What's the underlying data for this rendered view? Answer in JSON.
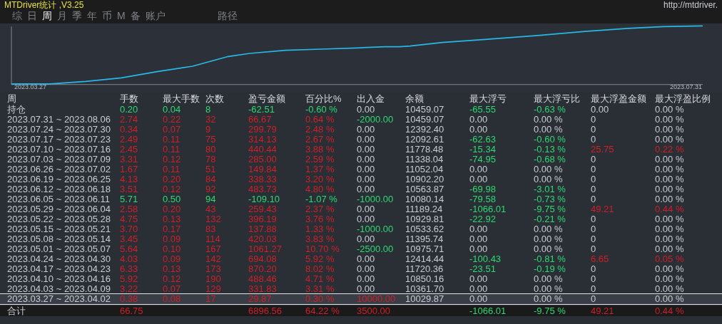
{
  "window": {
    "title": "MTDriver统计 ,V3.25",
    "url": "http://mtdriver."
  },
  "tabs": [
    {
      "label": "综",
      "selected": false
    },
    {
      "label": "日",
      "selected": false
    },
    {
      "label": "周",
      "selected": true
    },
    {
      "label": "月",
      "selected": false
    },
    {
      "label": "季",
      "selected": false
    },
    {
      "label": "年",
      "selected": false
    },
    {
      "label": "币",
      "selected": false
    },
    {
      "label": "M",
      "selected": false
    },
    {
      "label": "备",
      "selected": false
    },
    {
      "label": "账户",
      "selected": false
    },
    {
      "label": "路径",
      "selected": false
    }
  ],
  "chart": {
    "start_label": "2023.03.27",
    "end_label": "2023.07.31"
  },
  "table": {
    "columns": [
      "周",
      "手数",
      "最大手数",
      "次数",
      "盈亏金额",
      "百分比%",
      "出入金",
      "余额",
      "最大浮亏",
      "最大浮亏比",
      "最大浮盈金额",
      "最大浮盈比例"
    ],
    "rows": [
      {
        "selected": false,
        "cells": [
          {
            "text": "持仓"
          },
          {
            "text": "0.20",
            "color": "#2fd870"
          },
          {
            "text": "0.04",
            "color": "#2fd870"
          },
          {
            "text": "8",
            "color": "#2fd870"
          },
          {
            "text": "-62.51",
            "color": "#2fd870"
          },
          {
            "text": "-0.60 %",
            "color": "#2fd870"
          },
          {
            "text": "0.00"
          },
          {
            "text": "10459.07"
          },
          {
            "text": "-65.55",
            "color": "#2fd870"
          },
          {
            "text": "-0.63 %",
            "color": "#2fd870"
          },
          {
            "text": "0.00"
          },
          {
            "text": "0.00 %"
          }
        ]
      },
      {
        "selected": false,
        "cells": [
          {
            "text": "2023.07.31 ~ 2023.08.06"
          },
          {
            "text": "2.74",
            "color": "#d01f28"
          },
          {
            "text": "0.22",
            "color": "#d01f28"
          },
          {
            "text": "32",
            "color": "#d01f28"
          },
          {
            "text": "66.67",
            "color": "#d01f28"
          },
          {
            "text": "0.64 %",
            "color": "#d01f28"
          },
          {
            "text": "-2000.00",
            "color": "#2fd870"
          },
          {
            "text": "10459.07"
          },
          {
            "text": "0.00"
          },
          {
            "text": "0.00 %"
          },
          {
            "text": "0"
          },
          {
            "text": "0.00 %"
          }
        ]
      },
      {
        "selected": false,
        "cells": [
          {
            "text": "2023.07.24 ~ 2023.07.30"
          },
          {
            "text": "0.34",
            "color": "#d01f28"
          },
          {
            "text": "0.07",
            "color": "#d01f28"
          },
          {
            "text": "9",
            "color": "#d01f28"
          },
          {
            "text": "299.79",
            "color": "#d01f28"
          },
          {
            "text": "2.48 %",
            "color": "#d01f28"
          },
          {
            "text": "0.00"
          },
          {
            "text": "12392.40"
          },
          {
            "text": "0.00"
          },
          {
            "text": "0.00 %"
          },
          {
            "text": "0"
          },
          {
            "text": "0.00 %"
          }
        ]
      },
      {
        "selected": false,
        "cells": [
          {
            "text": "2023.07.17 ~ 2023.07.23"
          },
          {
            "text": "2.49",
            "color": "#d01f28"
          },
          {
            "text": "0.11",
            "color": "#d01f28"
          },
          {
            "text": "75",
            "color": "#d01f28"
          },
          {
            "text": "314.13",
            "color": "#d01f28"
          },
          {
            "text": "2.67 %",
            "color": "#d01f28"
          },
          {
            "text": "0.00"
          },
          {
            "text": "12092.61"
          },
          {
            "text": "-62.63",
            "color": "#2fd870"
          },
          {
            "text": "-0.60 %",
            "color": "#2fd870"
          },
          {
            "text": "0"
          },
          {
            "text": "0.00 %"
          }
        ]
      },
      {
        "selected": false,
        "cells": [
          {
            "text": "2023.07.10 ~ 2023.07.16"
          },
          {
            "text": "2.45",
            "color": "#d01f28"
          },
          {
            "text": "0.11",
            "color": "#d01f28"
          },
          {
            "text": "80",
            "color": "#d01f28"
          },
          {
            "text": "440.44",
            "color": "#d01f28"
          },
          {
            "text": "3.88 %",
            "color": "#d01f28"
          },
          {
            "text": "0.00"
          },
          {
            "text": "11778.48"
          },
          {
            "text": "-15.34",
            "color": "#2fd870"
          },
          {
            "text": "-0.13 %",
            "color": "#2fd870"
          },
          {
            "text": "25.75",
            "color": "#d01f28"
          },
          {
            "text": "0.22 %",
            "color": "#d01f28"
          }
        ]
      },
      {
        "selected": false,
        "cells": [
          {
            "text": "2023.07.03 ~ 2023.07.09"
          },
          {
            "text": "3.31",
            "color": "#d01f28"
          },
          {
            "text": "0.12",
            "color": "#d01f28"
          },
          {
            "text": "78",
            "color": "#d01f28"
          },
          {
            "text": "285.00",
            "color": "#d01f28"
          },
          {
            "text": "2.59 %",
            "color": "#d01f28"
          },
          {
            "text": "0.00"
          },
          {
            "text": "11338.04"
          },
          {
            "text": "-74.95",
            "color": "#2fd870"
          },
          {
            "text": "-0.68 %",
            "color": "#2fd870"
          },
          {
            "text": "0"
          },
          {
            "text": "0.00 %"
          }
        ]
      },
      {
        "selected": false,
        "cells": [
          {
            "text": "2023.06.26 ~ 2023.07.02"
          },
          {
            "text": "1.67",
            "color": "#d01f28"
          },
          {
            "text": "0.11",
            "color": "#d01f28"
          },
          {
            "text": "51",
            "color": "#d01f28"
          },
          {
            "text": "149.84",
            "color": "#d01f28"
          },
          {
            "text": "1.37 %",
            "color": "#d01f28"
          },
          {
            "text": "0.00"
          },
          {
            "text": "11052.04"
          },
          {
            "text": "0.00"
          },
          {
            "text": "0.00 %"
          },
          {
            "text": "0"
          },
          {
            "text": "0.00 %"
          }
        ]
      },
      {
        "selected": false,
        "cells": [
          {
            "text": "2023.06.19 ~ 2023.06.25"
          },
          {
            "text": "4.13",
            "color": "#d01f28"
          },
          {
            "text": "0.20",
            "color": "#d01f28"
          },
          {
            "text": "84",
            "color": "#d01f28"
          },
          {
            "text": "338.33",
            "color": "#d01f28"
          },
          {
            "text": "3.20 %",
            "color": "#d01f28"
          },
          {
            "text": "0.00"
          },
          {
            "text": "10902.20"
          },
          {
            "text": "0.00"
          },
          {
            "text": "0.00 %"
          },
          {
            "text": "0"
          },
          {
            "text": "0.00 %"
          }
        ]
      },
      {
        "selected": false,
        "cells": [
          {
            "text": "2023.06.12 ~ 2023.06.18"
          },
          {
            "text": "3.51",
            "color": "#d01f28"
          },
          {
            "text": "0.12",
            "color": "#d01f28"
          },
          {
            "text": "92",
            "color": "#d01f28"
          },
          {
            "text": "483.73",
            "color": "#d01f28"
          },
          {
            "text": "4.80 %",
            "color": "#d01f28"
          },
          {
            "text": "0.00"
          },
          {
            "text": "10563.87"
          },
          {
            "text": "-69.98",
            "color": "#2fd870"
          },
          {
            "text": "-3.01 %",
            "color": "#2fd870"
          },
          {
            "text": "0"
          },
          {
            "text": "0.00 %"
          }
        ]
      },
      {
        "selected": false,
        "cells": [
          {
            "text": "2023.06.05 ~ 2023.06.11"
          },
          {
            "text": "5.71",
            "color": "#2fd870"
          },
          {
            "text": "0.50",
            "color": "#2fd870"
          },
          {
            "text": "94",
            "color": "#2fd870"
          },
          {
            "text": "-109.10",
            "color": "#2fd870"
          },
          {
            "text": "-1.07 %",
            "color": "#2fd870"
          },
          {
            "text": "-1000.00",
            "color": "#2fd870"
          },
          {
            "text": "10080.14"
          },
          {
            "text": "-79.58",
            "color": "#2fd870"
          },
          {
            "text": "-0.73 %",
            "color": "#2fd870"
          },
          {
            "text": "0"
          },
          {
            "text": "0.00 %"
          }
        ]
      },
      {
        "selected": false,
        "cells": [
          {
            "text": "2023.05.29 ~ 2023.06.04"
          },
          {
            "text": "2.58",
            "color": "#d01f28"
          },
          {
            "text": "0.20",
            "color": "#d01f28"
          },
          {
            "text": "43",
            "color": "#d01f28"
          },
          {
            "text": "259.43",
            "color": "#d01f28"
          },
          {
            "text": "2.37 %",
            "color": "#d01f28"
          },
          {
            "text": "0.00"
          },
          {
            "text": "11189.24"
          },
          {
            "text": "-1066.01",
            "color": "#2fd870"
          },
          {
            "text": "-9.75 %",
            "color": "#2fd870"
          },
          {
            "text": "49.21",
            "color": "#d01f28"
          },
          {
            "text": "0.44 %",
            "color": "#d01f28"
          }
        ]
      },
      {
        "selected": false,
        "cells": [
          {
            "text": "2023.05.22 ~ 2023.05.28"
          },
          {
            "text": "4.75",
            "color": "#d01f28"
          },
          {
            "text": "0.13",
            "color": "#d01f28"
          },
          {
            "text": "132",
            "color": "#d01f28"
          },
          {
            "text": "396.19",
            "color": "#d01f28"
          },
          {
            "text": "3.76 %",
            "color": "#d01f28"
          },
          {
            "text": "0.00"
          },
          {
            "text": "10929.81"
          },
          {
            "text": "-22.92",
            "color": "#2fd870"
          },
          {
            "text": "-0.21 %",
            "color": "#2fd870"
          },
          {
            "text": "0"
          },
          {
            "text": "0.00 %"
          }
        ]
      },
      {
        "selected": false,
        "cells": [
          {
            "text": "2023.05.15 ~ 2023.05.21"
          },
          {
            "text": "3.70",
            "color": "#d01f28"
          },
          {
            "text": "0.17",
            "color": "#d01f28"
          },
          {
            "text": "83",
            "color": "#d01f28"
          },
          {
            "text": "137.88",
            "color": "#d01f28"
          },
          {
            "text": "1.33 %",
            "color": "#d01f28"
          },
          {
            "text": "-1000.00",
            "color": "#2fd870"
          },
          {
            "text": "10533.62"
          },
          {
            "text": "0.00"
          },
          {
            "text": "0.00 %"
          },
          {
            "text": "0"
          },
          {
            "text": "0.00 %"
          }
        ]
      },
      {
        "selected": false,
        "cells": [
          {
            "text": "2023.05.08 ~ 2023.05.14"
          },
          {
            "text": "3.45",
            "color": "#d01f28"
          },
          {
            "text": "0.09",
            "color": "#d01f28"
          },
          {
            "text": "114",
            "color": "#d01f28"
          },
          {
            "text": "420.03",
            "color": "#d01f28"
          },
          {
            "text": "3.83 %",
            "color": "#d01f28"
          },
          {
            "text": "0.00"
          },
          {
            "text": "11395.74"
          },
          {
            "text": "0.00"
          },
          {
            "text": "0.00 %"
          },
          {
            "text": "0"
          },
          {
            "text": "0.00 %"
          }
        ]
      },
      {
        "selected": false,
        "cells": [
          {
            "text": "2023.05.01 ~ 2023.05.07"
          },
          {
            "text": "5.64",
            "color": "#d01f28"
          },
          {
            "text": "0.10",
            "color": "#d01f28"
          },
          {
            "text": "167",
            "color": "#d01f28"
          },
          {
            "text": "1061.27",
            "color": "#d01f28"
          },
          {
            "text": "10.70 %",
            "color": "#d01f28"
          },
          {
            "text": "-2500.00",
            "color": "#2fd870"
          },
          {
            "text": "10975.71"
          },
          {
            "text": "0.00"
          },
          {
            "text": "0.00 %"
          },
          {
            "text": "0"
          },
          {
            "text": "0.00 %"
          }
        ]
      },
      {
        "selected": false,
        "cells": [
          {
            "text": "2023.04.24 ~ 2023.04.30"
          },
          {
            "text": "4.03",
            "color": "#d01f28"
          },
          {
            "text": "0.09",
            "color": "#d01f28"
          },
          {
            "text": "142",
            "color": "#d01f28"
          },
          {
            "text": "694.08",
            "color": "#d01f28"
          },
          {
            "text": "5.92 %",
            "color": "#d01f28"
          },
          {
            "text": "0.00"
          },
          {
            "text": "12414.44"
          },
          {
            "text": "-100.43",
            "color": "#2fd870"
          },
          {
            "text": "-0.81 %",
            "color": "#2fd870"
          },
          {
            "text": "6.65",
            "color": "#d01f28"
          },
          {
            "text": "0.05 %",
            "color": "#d01f28"
          }
        ]
      },
      {
        "selected": false,
        "cells": [
          {
            "text": "2023.04.17 ~ 2023.04.23"
          },
          {
            "text": "6.33",
            "color": "#d01f28"
          },
          {
            "text": "0.13",
            "color": "#d01f28"
          },
          {
            "text": "173",
            "color": "#d01f28"
          },
          {
            "text": "870.20",
            "color": "#d01f28"
          },
          {
            "text": "8.02 %",
            "color": "#d01f28"
          },
          {
            "text": "0.00"
          },
          {
            "text": "11720.36"
          },
          {
            "text": "-23.51",
            "color": "#2fd870"
          },
          {
            "text": "-0.19 %",
            "color": "#2fd870"
          },
          {
            "text": "0"
          },
          {
            "text": "0.00 %"
          }
        ]
      },
      {
        "selected": false,
        "cells": [
          {
            "text": "2023.04.10 ~ 2023.04.16"
          },
          {
            "text": "5.92",
            "color": "#d01f28"
          },
          {
            "text": "0.12",
            "color": "#d01f28"
          },
          {
            "text": "190",
            "color": "#d01f28"
          },
          {
            "text": "488.46",
            "color": "#d01f28"
          },
          {
            "text": "4.71 %",
            "color": "#d01f28"
          },
          {
            "text": "0.00"
          },
          {
            "text": "10850.16"
          },
          {
            "text": "0.00"
          },
          {
            "text": "0.00 %"
          },
          {
            "text": "0"
          },
          {
            "text": "0.00 %"
          }
        ]
      },
      {
        "selected": false,
        "cells": [
          {
            "text": "2023.04.03 ~ 2023.04.09"
          },
          {
            "text": "3.22",
            "color": "#d01f28"
          },
          {
            "text": "0.07",
            "color": "#d01f28"
          },
          {
            "text": "129",
            "color": "#d01f28"
          },
          {
            "text": "331.83",
            "color": "#d01f28"
          },
          {
            "text": "3.31 %",
            "color": "#d01f28"
          },
          {
            "text": "0.00"
          },
          {
            "text": "10361.70"
          },
          {
            "text": "0.00"
          },
          {
            "text": "0.00 %"
          },
          {
            "text": "0"
          },
          {
            "text": "0.00 %"
          }
        ]
      },
      {
        "selected": true,
        "cells": [
          {
            "text": "2023.03.27 ~ 2023.04.02"
          },
          {
            "text": "0.38",
            "color": "#d01f28"
          },
          {
            "text": "0.08",
            "color": "#d01f28"
          },
          {
            "text": "17",
            "color": "#d01f28"
          },
          {
            "text": "29.87",
            "color": "#d01f28"
          },
          {
            "text": "0.30 %",
            "color": "#d01f28"
          },
          {
            "text": "10000.00",
            "color": "#d01f28"
          },
          {
            "text": "10029.87"
          },
          {
            "text": "0.00"
          },
          {
            "text": "0.00 %"
          },
          {
            "text": "0"
          },
          {
            "text": "0.00 %"
          }
        ]
      }
    ],
    "total": {
      "label": "合计",
      "cells": [
        {
          "text": "66.75",
          "color": "#d01f28"
        },
        null,
        null,
        {
          "text": "6896.56",
          "color": "#d01f28"
        },
        {
          "text": "64.22 %",
          "color": "#d01f28"
        },
        {
          "text": "3500.00",
          "color": "#d01f28"
        },
        null,
        {
          "text": "-1066.01",
          "color": "#2fd870"
        },
        {
          "text": "-9.75 %",
          "color": "#2fd870"
        },
        {
          "text": "49.21",
          "color": "#d01f28"
        },
        {
          "text": "0.44 %",
          "color": "#d01f28"
        }
      ]
    }
  }
}
